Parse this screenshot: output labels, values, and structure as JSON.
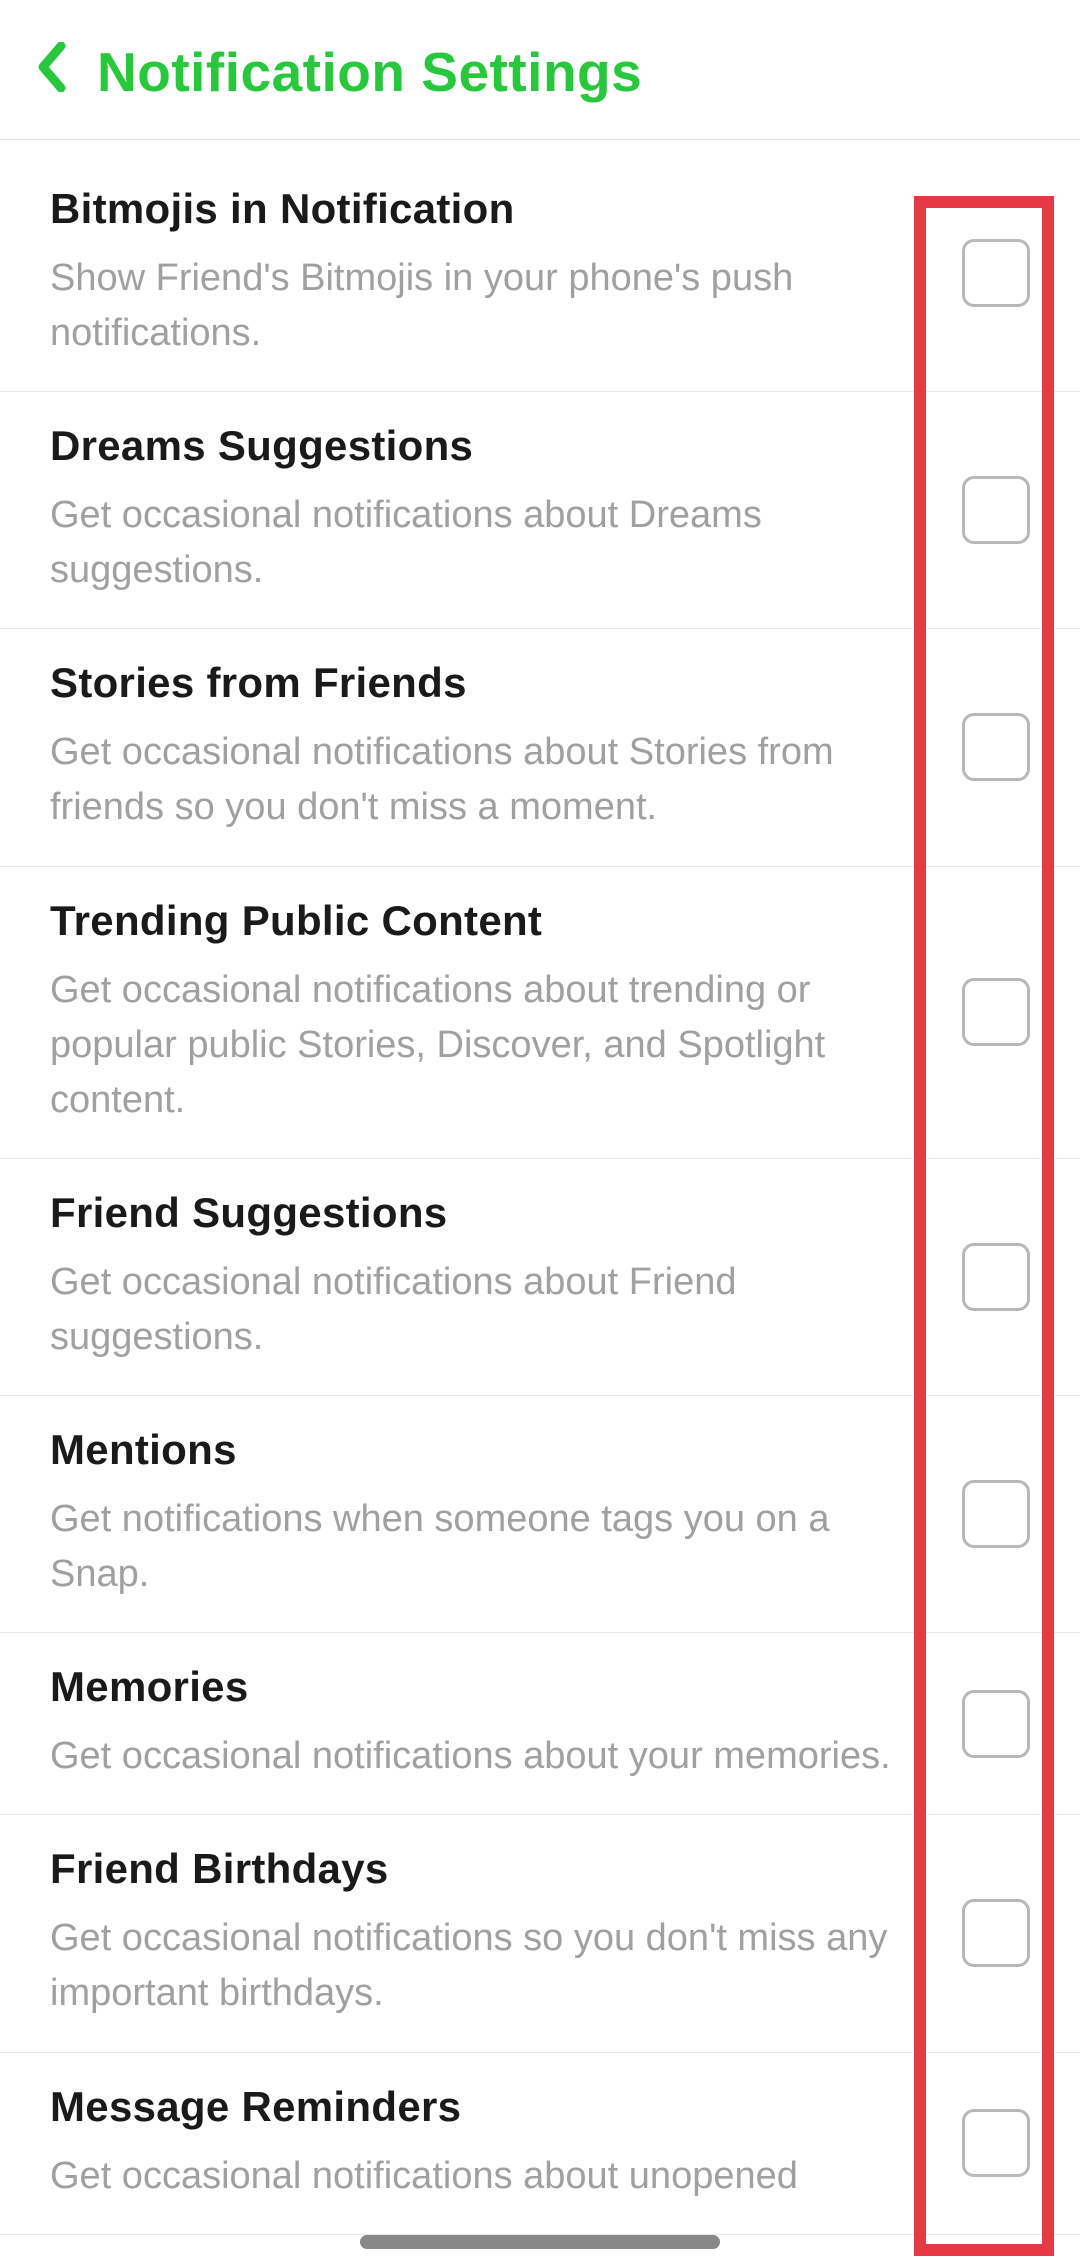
{
  "header": {
    "title": "Notification Settings"
  },
  "settings": [
    {
      "id": "bitmojis",
      "title": "Bitmojis in Notification",
      "description": "Show Friend's Bitmojis in your phone's push notifications."
    },
    {
      "id": "dreams",
      "title": "Dreams Suggestions",
      "description": "Get occasional notifications about Dreams suggestions."
    },
    {
      "id": "stories",
      "title": "Stories from Friends",
      "description": "Get occasional notifications about Stories from friends so you don't miss a moment."
    },
    {
      "id": "trending",
      "title": "Trending Public Content",
      "description": "Get occasional notifications about trending or popular public Stories, Discover, and Spotlight content."
    },
    {
      "id": "friend-suggestions",
      "title": "Friend Suggestions",
      "description": "Get occasional notifications about Friend suggestions."
    },
    {
      "id": "mentions",
      "title": "Mentions",
      "description": "Get notifications when someone tags you on a Snap."
    },
    {
      "id": "memories",
      "title": "Memories",
      "description": "Get occasional notifications about your memories."
    },
    {
      "id": "birthdays",
      "title": "Friend Birthdays",
      "description": "Get occasional notifications so you don't miss any important birthdays."
    },
    {
      "id": "message-reminders",
      "title": "Message Reminders",
      "description": "Get occasional notifications about unopened"
    }
  ]
}
